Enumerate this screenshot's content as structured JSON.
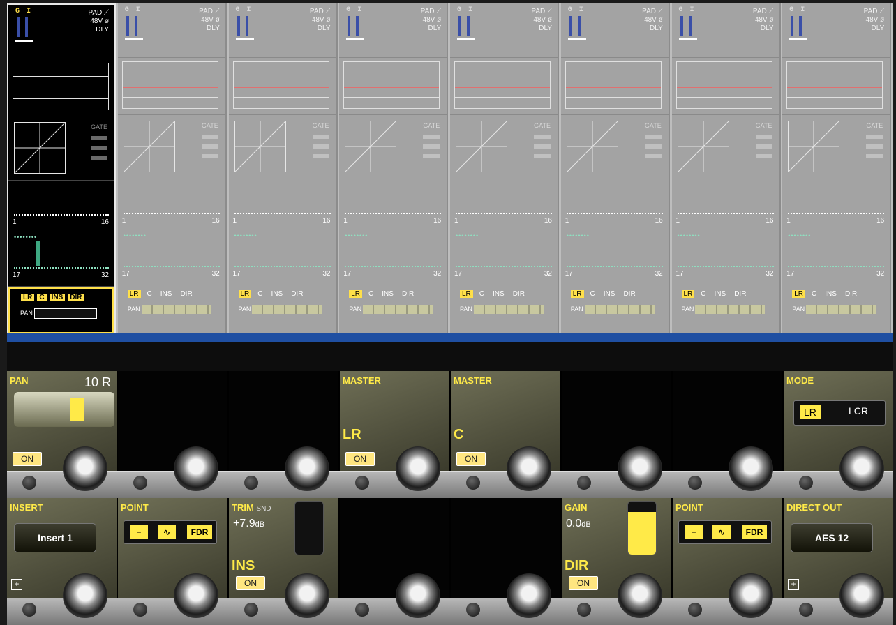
{
  "channels": [
    {
      "selected": true,
      "gt": "G I",
      "pad": "PAD",
      "v48": "48V",
      "dly": "DLY",
      "gate": "GATE",
      "b1": "1",
      "b16": "16",
      "b17": "17",
      "b32": "32",
      "lr": "LR",
      "c": "C",
      "ins": "INS",
      "dir": "DIR",
      "pan": "PAN"
    },
    {
      "selected": false,
      "gt": "G I",
      "pad": "PAD",
      "v48": "48V",
      "dly": "DLY",
      "gate": "GATE",
      "b1": "1",
      "b16": "16",
      "b17": "17",
      "b32": "32",
      "lr": "LR",
      "c": "C",
      "ins": "INS",
      "dir": "DIR",
      "pan": "PAN"
    },
    {
      "selected": false,
      "gt": "G I",
      "pad": "PAD",
      "v48": "48V",
      "dly": "DLY",
      "gate": "GATE",
      "b1": "1",
      "b16": "16",
      "b17": "17",
      "b32": "32",
      "lr": "LR",
      "c": "C",
      "ins": "INS",
      "dir": "DIR",
      "pan": "PAN"
    },
    {
      "selected": false,
      "gt": "G I",
      "pad": "PAD",
      "v48": "48V",
      "dly": "DLY",
      "gate": "GATE",
      "b1": "1",
      "b16": "16",
      "b17": "17",
      "b32": "32",
      "lr": "LR",
      "c": "C",
      "ins": "INS",
      "dir": "DIR",
      "pan": "PAN"
    },
    {
      "selected": false,
      "gt": "G I",
      "pad": "PAD",
      "v48": "48V",
      "dly": "DLY",
      "gate": "GATE",
      "b1": "1",
      "b16": "16",
      "b17": "17",
      "b32": "32",
      "lr": "LR",
      "c": "C",
      "ins": "INS",
      "dir": "DIR",
      "pan": "PAN"
    },
    {
      "selected": false,
      "gt": "G I",
      "pad": "PAD",
      "v48": "48V",
      "dly": "DLY",
      "gate": "GATE",
      "b1": "1",
      "b16": "16",
      "b17": "17",
      "b32": "32",
      "lr": "LR",
      "c": "C",
      "ins": "INS",
      "dir": "DIR",
      "pan": "PAN"
    },
    {
      "selected": false,
      "gt": "G I",
      "pad": "PAD",
      "v48": "48V",
      "dly": "DLY",
      "gate": "GATE",
      "b1": "1",
      "b16": "16",
      "b17": "17",
      "b32": "32",
      "lr": "LR",
      "c": "C",
      "ins": "INS",
      "dir": "DIR",
      "pan": "PAN"
    },
    {
      "selected": false,
      "gt": "G I",
      "pad": "PAD",
      "v48": "48V",
      "dly": "DLY",
      "gate": "GATE",
      "b1": "1",
      "b16": "16",
      "b17": "17",
      "b32": "32",
      "lr": "LR",
      "c": "C",
      "ins": "INS",
      "dir": "DIR",
      "pan": "PAN"
    }
  ],
  "top": {
    "pan": {
      "label": "PAN",
      "value": "10 R",
      "on": "ON",
      "position": 0.6
    },
    "master_lr": {
      "label": "MASTER",
      "big": "LR",
      "on": "ON"
    },
    "master_c": {
      "label": "MASTER",
      "big": "C",
      "on": "ON"
    },
    "mode": {
      "label": "MODE",
      "lr": "LR",
      "lcr": "LCR"
    }
  },
  "bottom": {
    "insert": {
      "label": "INSERT",
      "button": "Insert 1",
      "plus": "+"
    },
    "point1": {
      "label": "POINT",
      "fdr": "FDR"
    },
    "trim": {
      "label": "TRIM",
      "snd": "SND",
      "value": "+7.9",
      "unit": "dB",
      "ins": "INS",
      "on": "ON"
    },
    "gain": {
      "label": "GAIN",
      "value": "0.0",
      "unit": "dB",
      "dir": "DIR",
      "on": "ON"
    },
    "point2": {
      "label": "POINT",
      "fdr": "FDR"
    },
    "direct_out": {
      "label": "DIRECT OUT",
      "button": "AES 12",
      "plus": "+"
    }
  },
  "colors": {
    "accent": "#ffea48",
    "selected_outline": "#ffe04a",
    "blue_band": "#1f4fa2"
  }
}
